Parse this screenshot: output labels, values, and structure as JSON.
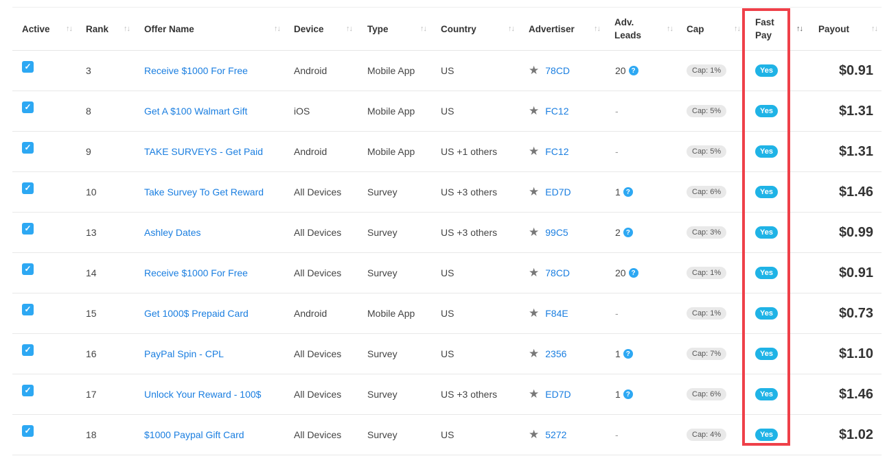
{
  "columns": {
    "active": "Active",
    "rank": "Rank",
    "offer_name": "Offer Name",
    "device": "Device",
    "type": "Type",
    "country": "Country",
    "advertiser": "Advertiser",
    "adv_leads_1": "Adv.",
    "adv_leads_2": "Leads",
    "cap": "Cap",
    "fast_pay_1": "Fast",
    "fast_pay_2": "Pay",
    "payout": "Payout",
    "sort_icon": "↑↓"
  },
  "rows": [
    {
      "rank": "3",
      "offer": "Receive $1000 For Free",
      "device": "Android",
      "type": "Mobile App",
      "country": "US",
      "advertiser": "78CD",
      "leads": "20",
      "leads_help": true,
      "cap": "Cap: 1%",
      "fast_pay": "Yes",
      "payout": "$0.91"
    },
    {
      "rank": "8",
      "offer": "Get A $100 Walmart Gift",
      "device": "iOS",
      "type": "Mobile App",
      "country": "US",
      "advertiser": "FC12",
      "leads": "-",
      "leads_help": false,
      "cap": "Cap: 5%",
      "fast_pay": "Yes",
      "payout": "$1.31"
    },
    {
      "rank": "9",
      "offer": "TAKE SURVEYS - Get Paid",
      "device": "Android",
      "type": "Mobile App",
      "country": "US +1 others",
      "advertiser": "FC12",
      "leads": "-",
      "leads_help": false,
      "cap": "Cap: 5%",
      "fast_pay": "Yes",
      "payout": "$1.31"
    },
    {
      "rank": "10",
      "offer": "Take Survey To Get Reward",
      "device": "All Devices",
      "type": "Survey",
      "country": "US +3 others",
      "advertiser": "ED7D",
      "leads": "1",
      "leads_help": true,
      "cap": "Cap: 6%",
      "fast_pay": "Yes",
      "payout": "$1.46"
    },
    {
      "rank": "13",
      "offer": "Ashley Dates",
      "device": "All Devices",
      "type": "Survey",
      "country": "US +3 others",
      "advertiser": "99C5",
      "leads": "2",
      "leads_help": true,
      "cap": "Cap: 3%",
      "fast_pay": "Yes",
      "payout": "$0.99"
    },
    {
      "rank": "14",
      "offer": "Receive $1000 For Free",
      "device": "All Devices",
      "type": "Survey",
      "country": "US",
      "advertiser": "78CD",
      "leads": "20",
      "leads_help": true,
      "cap": "Cap: 1%",
      "fast_pay": "Yes",
      "payout": "$0.91"
    },
    {
      "rank": "15",
      "offer": "Get 1000$ Prepaid Card",
      "device": "Android",
      "type": "Mobile App",
      "country": "US",
      "advertiser": "F84E",
      "leads": "-",
      "leads_help": false,
      "cap": "Cap: 1%",
      "fast_pay": "Yes",
      "payout": "$0.73"
    },
    {
      "rank": "16",
      "offer": "PayPal Spin - CPL",
      "device": "All Devices",
      "type": "Survey",
      "country": "US",
      "advertiser": "2356",
      "leads": "1",
      "leads_help": true,
      "cap": "Cap: 7%",
      "fast_pay": "Yes",
      "payout": "$1.10"
    },
    {
      "rank": "17",
      "offer": "Unlock Your Reward - 100$",
      "device": "All Devices",
      "type": "Survey",
      "country": "US +3 others",
      "advertiser": "ED7D",
      "leads": "1",
      "leads_help": true,
      "cap": "Cap: 6%",
      "fast_pay": "Yes",
      "payout": "$1.46"
    },
    {
      "rank": "18",
      "offer": "$1000 Paypal Gift Card",
      "device": "All Devices",
      "type": "Survey",
      "country": "US",
      "advertiser": "5272",
      "leads": "-",
      "leads_help": false,
      "cap": "Cap: 4%",
      "fast_pay": "Yes",
      "payout": "$1.02"
    }
  ],
  "icons": {
    "check": "check-icon",
    "star": "star-icon",
    "help": "question-circle-icon"
  },
  "colors": {
    "accent": "#2da8f3",
    "link": "#1a7ee0",
    "fast_pay_badge": "#1fb3e6",
    "highlight": "#ef4049"
  }
}
